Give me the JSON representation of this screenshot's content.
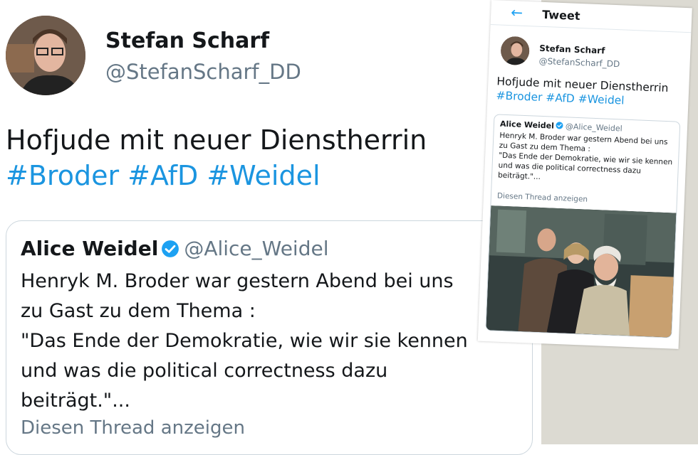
{
  "main_tweet": {
    "author_name": "Stefan Scharf",
    "author_handle": "@StefanScharf_DD",
    "text": "Hofjude mit neuer Dienstherrin",
    "hashtags": "#Broder #AfD #Weidel"
  },
  "quoted_tweet": {
    "author_name": "Alice Weidel",
    "author_handle": "@Alice_Weidel",
    "body_lines": [
      "Henryk M. Broder war gestern Abend bei uns",
      "zu Gast zu dem Thema :",
      "\"Das Ende der Demokratie, wie wir sie kennen",
      "und was die political correctness dazu",
      "beiträgt.\"..."
    ],
    "show_thread": "Diesen Thread anzeigen"
  },
  "mini_screenshot": {
    "header_title": "Tweet",
    "author_name": "Stefan Scharf",
    "author_handle": "@StefanScharf_DD",
    "text": "Hofjude mit neuer Dienstherrin",
    "hashtags": "#Broder #AfD #Weidel",
    "quote_author": "Alice Weidel",
    "quote_handle": "@Alice_Weidel",
    "quote_lines": [
      "Henryk M. Broder war gestern Abend bei uns",
      "zu Gast zu dem Thema :",
      "\"Das Ende der Demokratie, wie wir sie kennen",
      "und was die political correctness dazu",
      "beiträgt.\"..."
    ],
    "show_thread": "Diesen Thread anzeigen"
  },
  "icons": {
    "verified": "verified-badge-icon",
    "back": "back-arrow-icon"
  },
  "colors": {
    "hashtag": "#1b95e0",
    "muted": "#657786",
    "verified": "#1da1f2",
    "border": "#ccd6dd"
  }
}
